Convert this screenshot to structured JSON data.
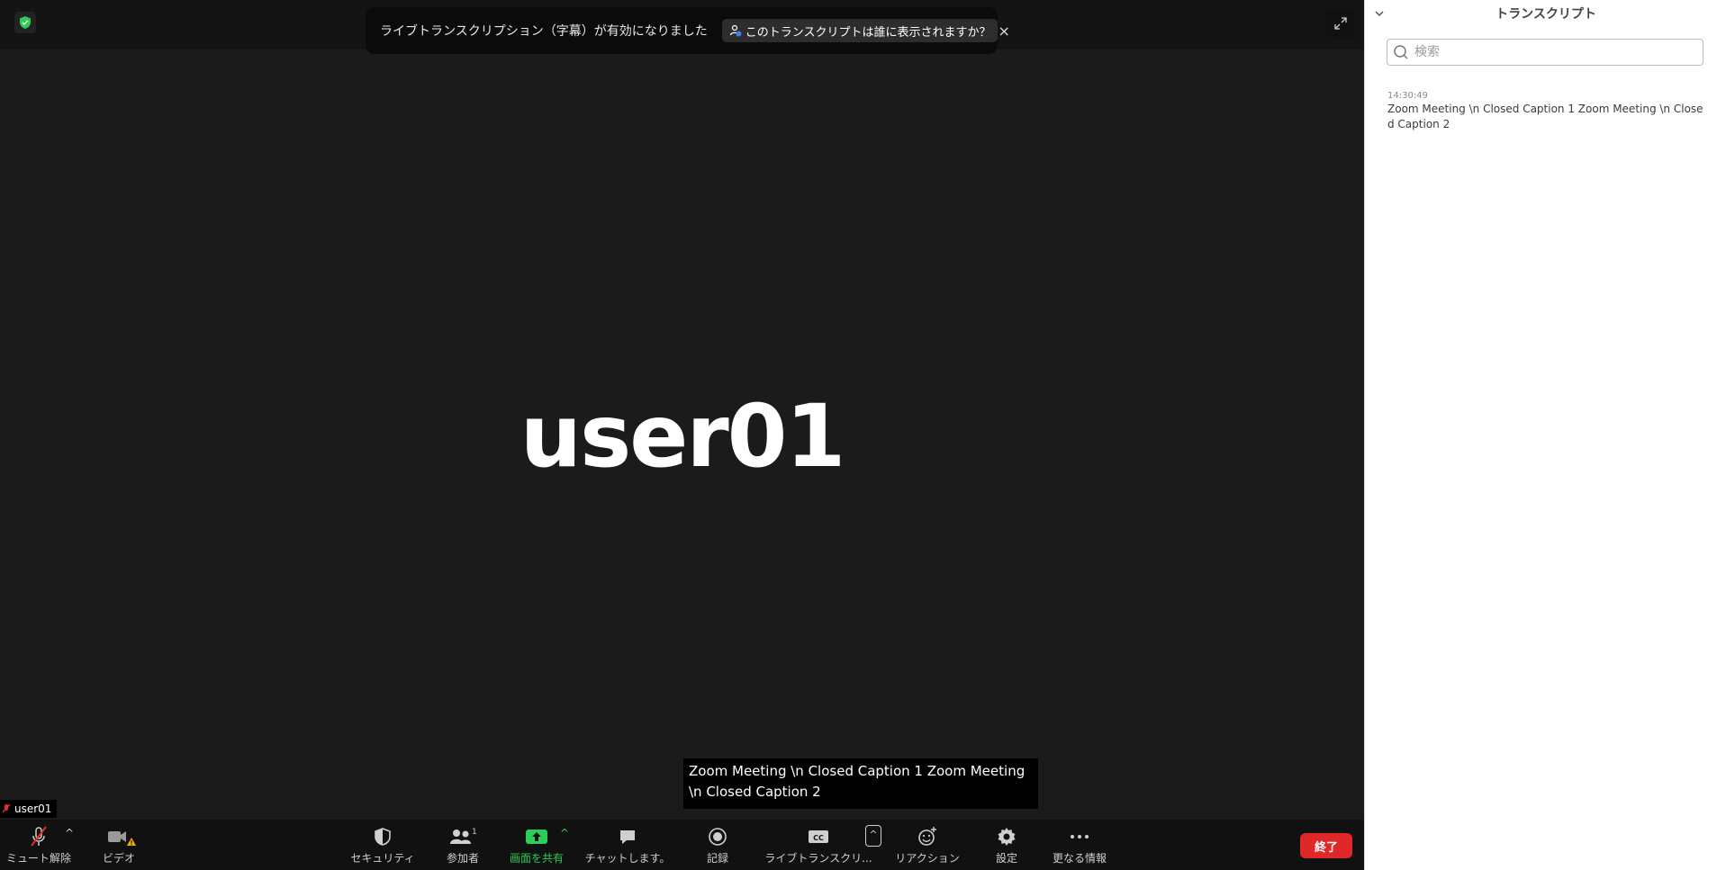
{
  "meeting": {
    "participant_name": "user01",
    "name_tag": "user01",
    "caption_text": "Zoom Meeting \\n Closed Caption 1 Zoom Meeting \\n Closed Caption 2"
  },
  "notice": {
    "text": "ライブトランスクリプション（字幕）が有効になりました",
    "pill": "このトランスクリプトは誰に表示されますか？",
    "close": "×"
  },
  "toolbar": {
    "mute": "ミュート解除",
    "video": "ビデオ",
    "security": "セキュリティ",
    "participants": "参加者",
    "participants_count": "1",
    "share": "画面を共有",
    "chat": "チャットします。",
    "record": "記録",
    "live_transcript": "ライブトランスクリ...",
    "cc_text": "CC",
    "reactions": "リアクション",
    "settings": "設定",
    "more": "更なる情報",
    "end": "終了"
  },
  "transcript_panel": {
    "title": "トランスクリプト",
    "search_placeholder": "検索",
    "entries": [
      {
        "time": "14:30:49",
        "text": "Zoom Meeting \\n Closed Caption 1 Zoom Meeting \\n Closed Caption 2"
      }
    ]
  },
  "colors": {
    "stage_bg": "#1b1b1b",
    "toolbar_bg": "#111111",
    "share_green": "#2ecc5a",
    "end_red": "#e02828",
    "security_green": "#2ecc5a"
  },
  "icons": {
    "shield": "shield-check-icon",
    "fullscreen": "expand-icon",
    "mic": "microphone-muted-icon",
    "video": "video-camera-warning-icon",
    "security": "shield-icon",
    "participants": "people-icon",
    "share": "share-screen-icon",
    "chat": "chat-bubble-icon",
    "record": "record-icon",
    "cc": "closed-caption-icon",
    "reactions": "smiley-add-icon",
    "settings": "gear-icon",
    "more": "ellipsis-icon",
    "search": "search-icon"
  }
}
